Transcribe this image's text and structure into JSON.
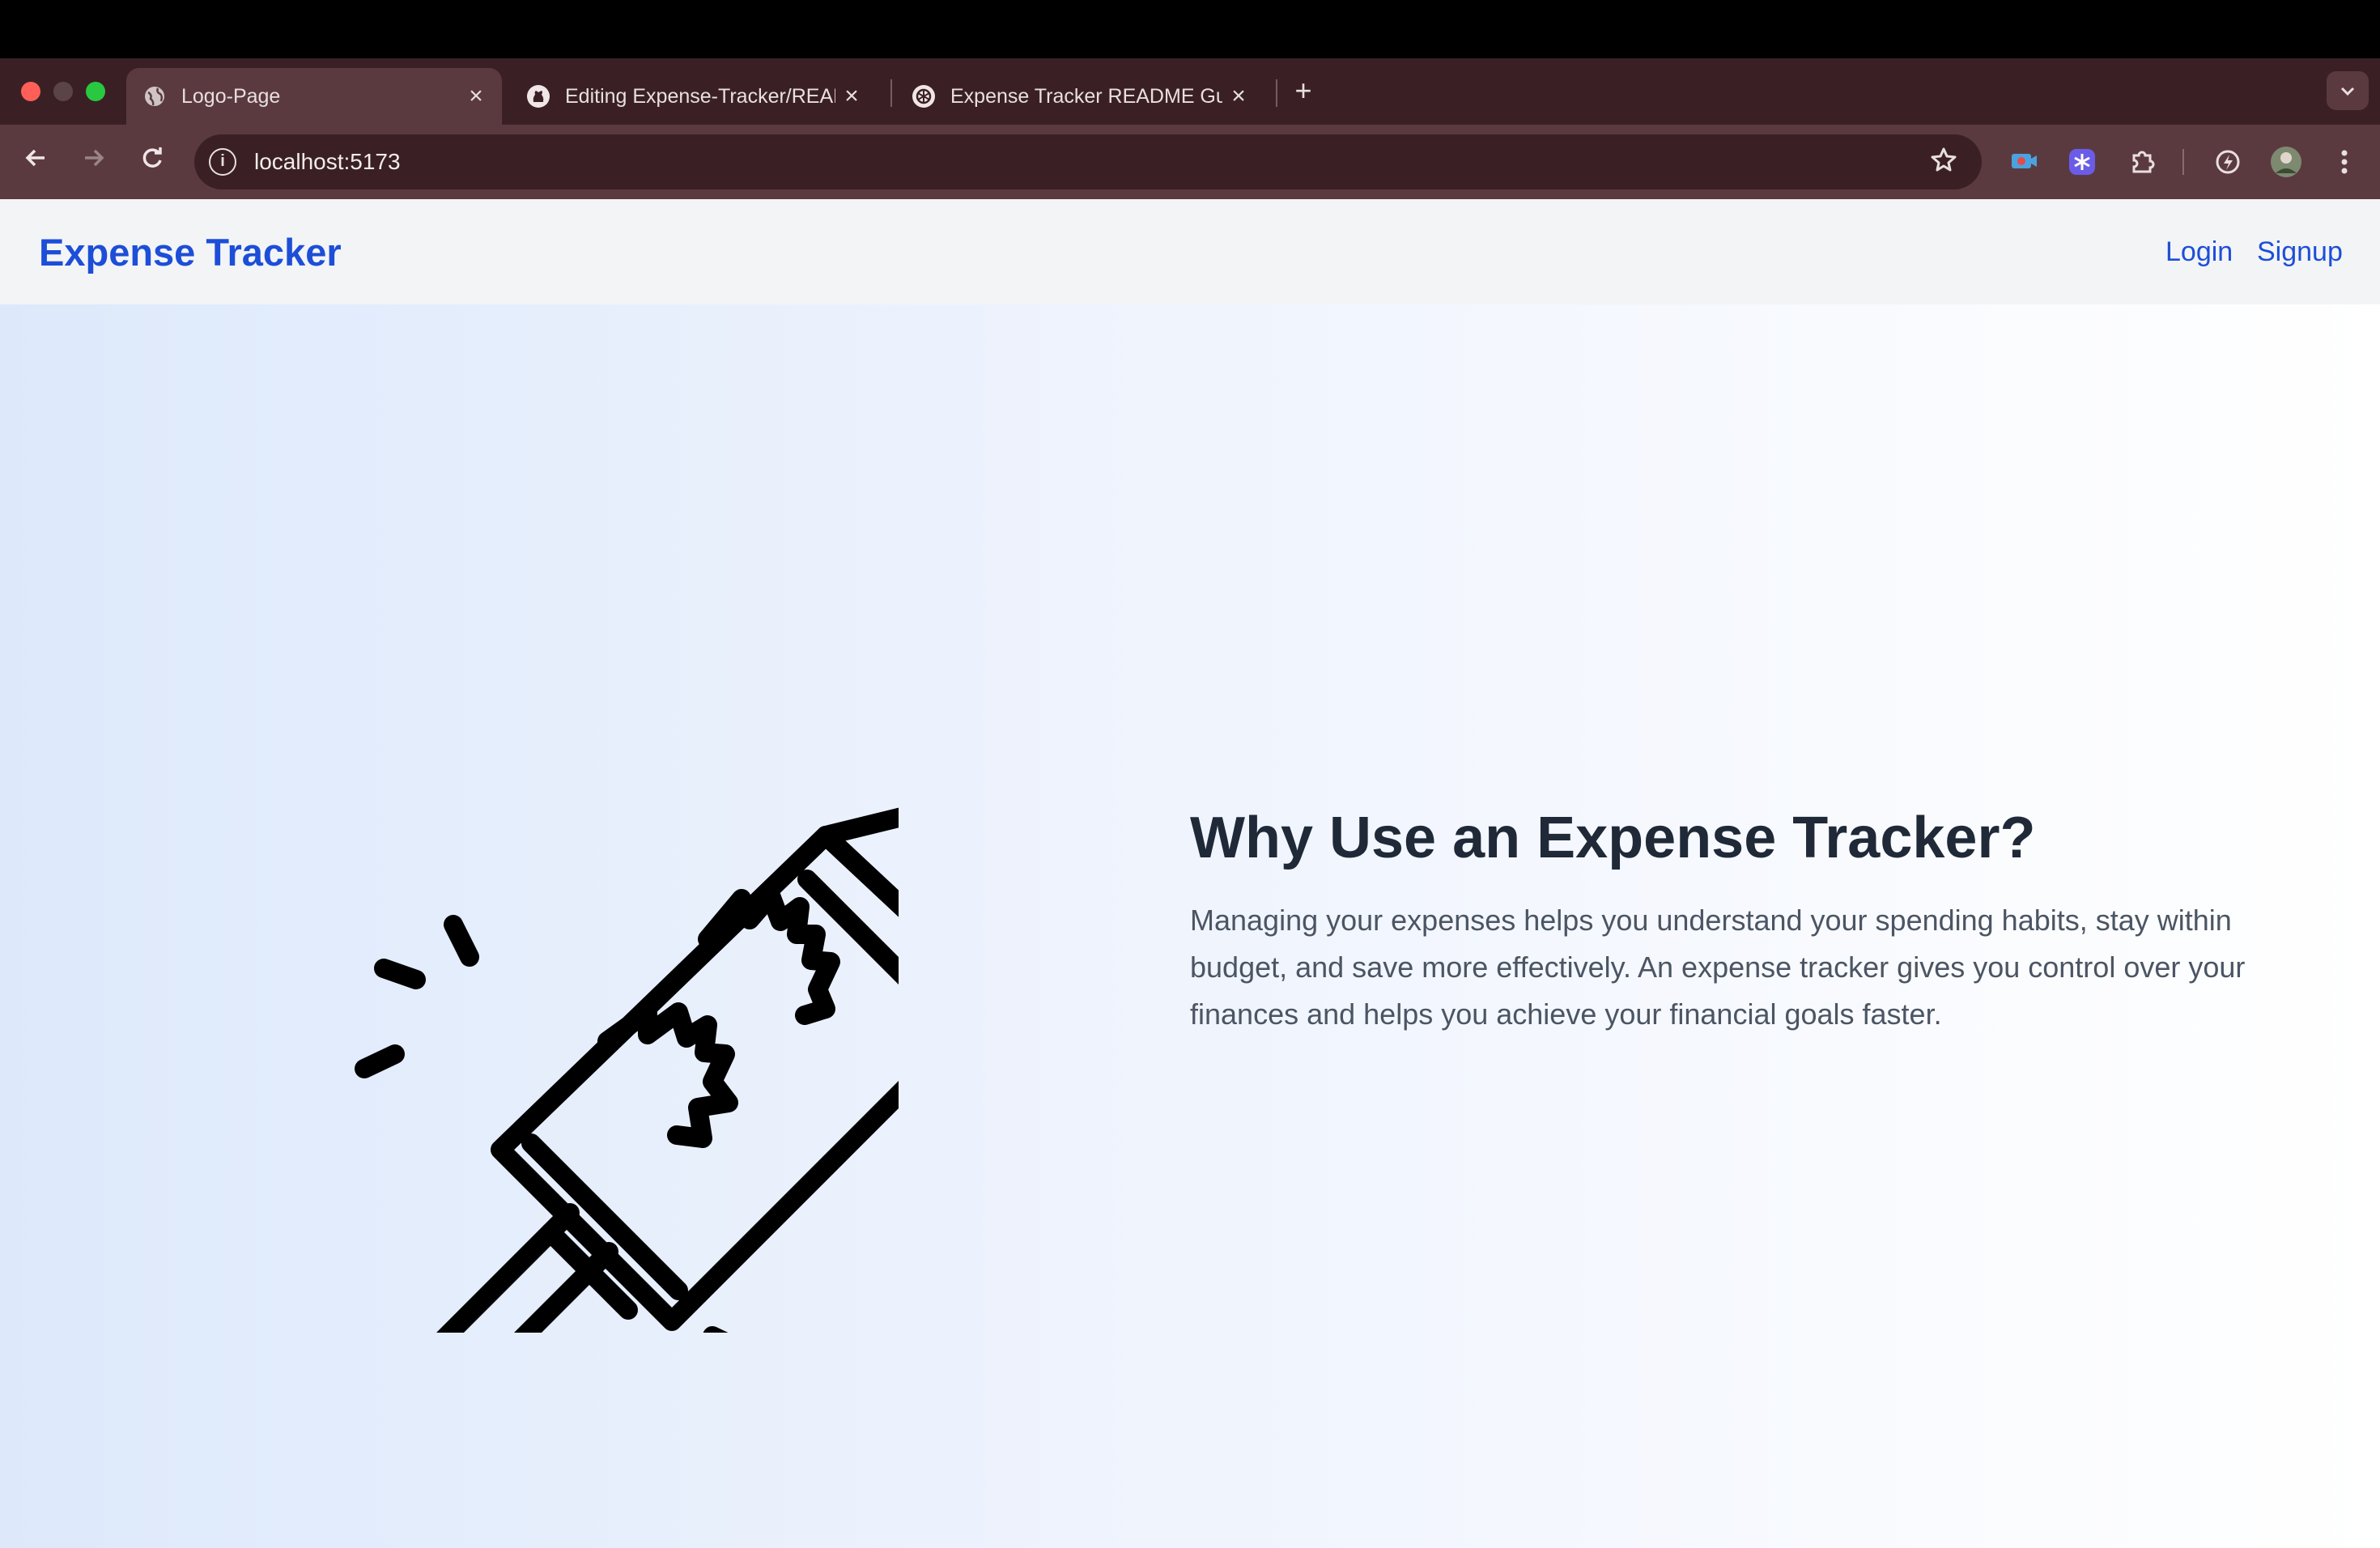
{
  "browser": {
    "tabs": [
      {
        "title": "Logo-Page",
        "icon": "globe-icon",
        "active": true
      },
      {
        "title": "Editing Expense-Tracker/README",
        "icon": "github-icon",
        "active": false
      },
      {
        "title": "Expense Tracker README Guide",
        "icon": "openai-icon",
        "active": false
      }
    ],
    "close_glyph": "×",
    "new_tab_glyph": "+",
    "url": "localhost:5173"
  },
  "app": {
    "brand": "Expense Tracker",
    "nav": {
      "login": "Login",
      "signup": "Signup"
    }
  },
  "hero": {
    "heading": "Why Use an Expense Tracker?",
    "paragraph": "Managing your expenses helps you understand your spending habits, stay within budget, and save more effectively. An expense tracker gives you control over your finances and helps you achieve your financial goals faster.",
    "illustration": "rocket-icon"
  },
  "colors": {
    "brand": "#1d4ed8",
    "heading": "#1f2937",
    "paragraph": "#4b5563",
    "tab_strip": "#3a2024",
    "toolbar": "#5b3a3f"
  }
}
